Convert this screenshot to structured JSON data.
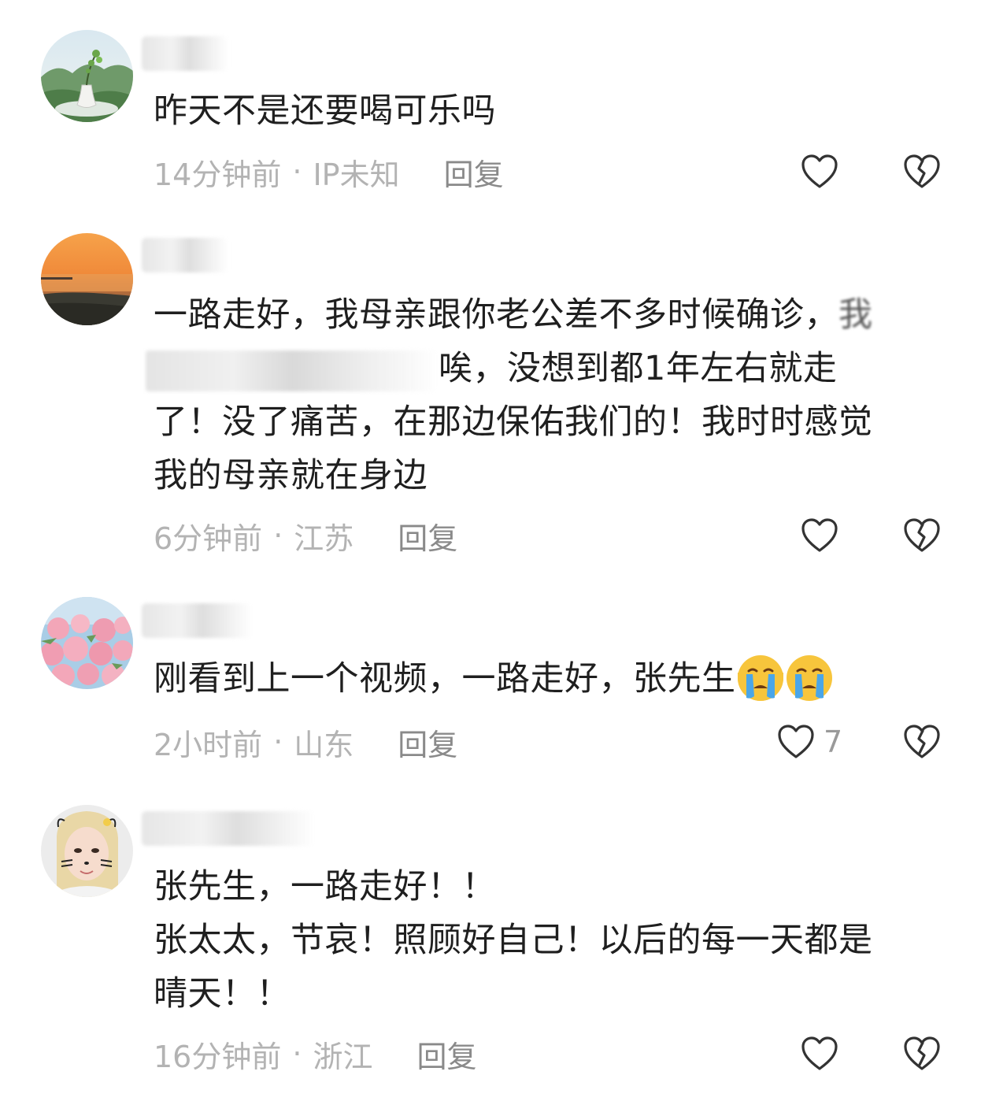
{
  "comments": [
    {
      "avatar": "bonsai-vase-avatar",
      "text_lines": [
        "昨天不是还要喝可乐吗"
      ],
      "time": "14分钟前",
      "location": "IP未知",
      "reply_label": "回复",
      "like_count": ""
    },
    {
      "avatar": "sunset-lake-avatar",
      "text_line_1": "一路走好，我母亲跟你老公差不多时候确诊，",
      "text_line_1_tail": "我",
      "text_line_2": "唉，没想到都1年左右就走",
      "text_line_3": "了！没了痛苦，在那边保佑我们的！我时时感觉",
      "text_line_4": "我的母亲就在身边",
      "time": "6分钟前",
      "location": "江苏",
      "reply_label": "回复",
      "like_count": ""
    },
    {
      "avatar": "pink-roses-avatar",
      "text": "刚看到上一个视频，一路走好，张先生",
      "emojis": [
        "crying-face-icon",
        "crying-face-icon"
      ],
      "time": "2小时前",
      "location": "山东",
      "reply_label": "回复",
      "like_count": "7"
    },
    {
      "avatar": "cat-filter-selfie-avatar",
      "text_lines": [
        "张先生，一路走好！！",
        "张太太，节哀！照顾好自己！以后的每一天都是",
        "晴天！！"
      ],
      "time": "16分钟前",
      "location": "浙江",
      "reply_label": "回复",
      "like_count": ""
    }
  ],
  "separator": "·",
  "icons": {
    "like": "heart-outline-icon",
    "dislike": "broken-heart-icon"
  },
  "colors": {
    "text": "#1f1f1f",
    "meta": "#b3b3b3",
    "reply": "#8a8a8a",
    "icon": "#333333"
  }
}
